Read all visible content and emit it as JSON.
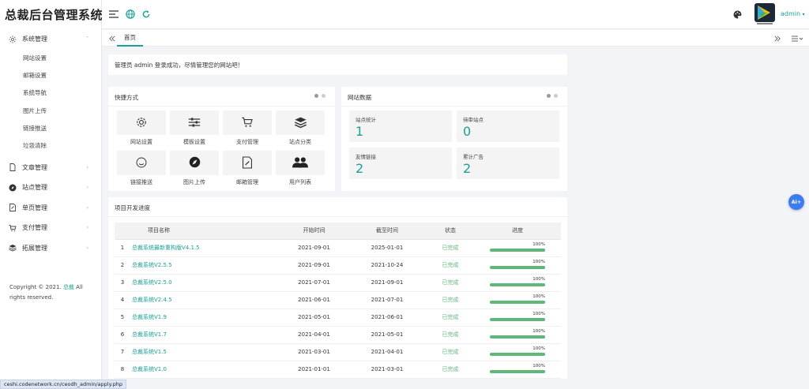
{
  "app_title": "总裁后台管理系统",
  "sidebar": {
    "menus": [
      {
        "label": "系统管理",
        "icon": "gear-icon",
        "expanded": true
      },
      {
        "label": "文章管理",
        "icon": "file-icon"
      },
      {
        "label": "站点管理",
        "icon": "compass-icon"
      },
      {
        "label": "单页管理",
        "icon": "page-edit-icon"
      },
      {
        "label": "支付管理",
        "icon": "cart-icon"
      },
      {
        "label": "拓展管理",
        "icon": "layers-icon"
      }
    ],
    "submenu": [
      "网站设置",
      "邮箱设置",
      "系统导航",
      "图片上传",
      "链接推送",
      "垃圾清除"
    ],
    "copyright_prefix": "Copyright © 2021.",
    "copyright_link": "总裁",
    "copyright_suffix": "All rights reserved."
  },
  "topbar": {
    "icons": [
      "menu-toggle-icon",
      "globe-icon",
      "refresh-icon",
      "palette-icon"
    ],
    "user": "admin",
    "accent": "#1aa094"
  },
  "tabs": {
    "home": "首页"
  },
  "notice": "管理员 admin 登录成功，尽情管理您的网站吧！",
  "shortcuts": {
    "title": "快捷方式",
    "items": [
      {
        "label": "网站设置",
        "icon": "gear-icon"
      },
      {
        "label": "模板设置",
        "icon": "sliders-icon"
      },
      {
        "label": "支付管理",
        "icon": "cart-icon"
      },
      {
        "label": "站点分类",
        "icon": "layers-icon"
      },
      {
        "label": "链接推送",
        "icon": "smile-icon"
      },
      {
        "label": "图片上传",
        "icon": "compass-icon"
      },
      {
        "label": "邮箱管理",
        "icon": "page-edit-icon"
      },
      {
        "label": "用户列表",
        "icon": "users-icon"
      }
    ]
  },
  "site_data": {
    "title": "网站数据",
    "stats": [
      {
        "label": "站点统计",
        "value": "1"
      },
      {
        "label": "待审站点",
        "value": "0"
      },
      {
        "label": "友情链接",
        "value": "2"
      },
      {
        "label": "累计广告",
        "value": "2"
      }
    ]
  },
  "projects": {
    "title": "项目开发进度",
    "headers": [
      "",
      "项目名称",
      "开始时间",
      "截至时间",
      "状态",
      "进度"
    ],
    "rows": [
      {
        "idx": "1",
        "name": "总裁系统最新重构版V4.1.5",
        "start": "2021-09-01",
        "end": "2025-01-01",
        "status": "已完成",
        "progress": 100,
        "progress_text": "100%"
      },
      {
        "idx": "2",
        "name": "总裁系统V2.5.5",
        "start": "2021-09-01",
        "end": "2021-10-24",
        "status": "已完成",
        "progress": 100,
        "progress_text": "100%"
      },
      {
        "idx": "3",
        "name": "总裁系统V2.5.0",
        "start": "2021-07-01",
        "end": "2021-09-01",
        "status": "已完成",
        "progress": 100,
        "progress_text": "100%"
      },
      {
        "idx": "4",
        "name": "总裁系统V2.4.5",
        "start": "2021-06-01",
        "end": "2021-07-01",
        "status": "已完成",
        "progress": 100,
        "progress_text": "100%"
      },
      {
        "idx": "5",
        "name": "总裁系统V1.9",
        "start": "2021-05-01",
        "end": "2021-06-01",
        "status": "已完成",
        "progress": 100,
        "progress_text": "100%"
      },
      {
        "idx": "6",
        "name": "总裁系统V1.7",
        "start": "2021-04-01",
        "end": "2021-05-01",
        "status": "已完成",
        "progress": 100,
        "progress_text": "100%"
      },
      {
        "idx": "7",
        "name": "总裁系统V1.5",
        "start": "2021-03-01",
        "end": "2021-04-01",
        "status": "已完成",
        "progress": 100,
        "progress_text": "100%"
      },
      {
        "idx": "8",
        "name": "总裁系统V1.0",
        "start": "2021-01-01",
        "end": "2021-03-01",
        "status": "已完成",
        "progress": 100,
        "progress_text": "100%"
      }
    ]
  },
  "ai_button": "Ai+",
  "status_url": "ceshi.codenetwork.cn/ceodh_admin/apply.php"
}
